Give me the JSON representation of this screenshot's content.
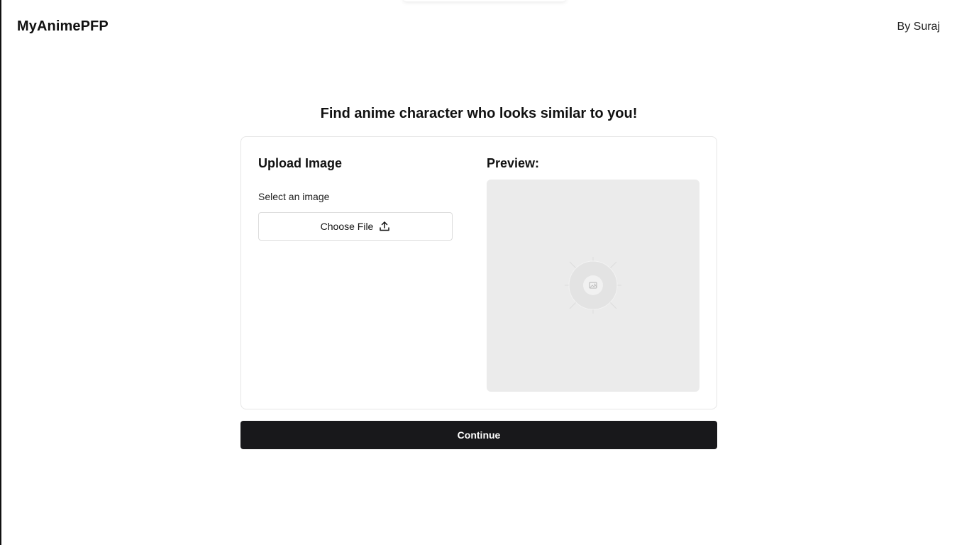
{
  "header": {
    "brand": "MyAnimePFP",
    "author": "By Suraj"
  },
  "main": {
    "headline": "Find anime character who looks similar to you!",
    "upload": {
      "title": "Upload Image",
      "select_label": "Select an image",
      "choose_file_label": "Choose File",
      "choose_file_icon": "upload-icon"
    },
    "preview": {
      "title": "Preview:",
      "placeholder_icon": "image-placeholder-icon"
    },
    "continue_label": "Continue"
  },
  "colors": {
    "primary_button": "#18181b",
    "preview_background": "#ebebeb",
    "card_border": "#e6e6e6"
  }
}
